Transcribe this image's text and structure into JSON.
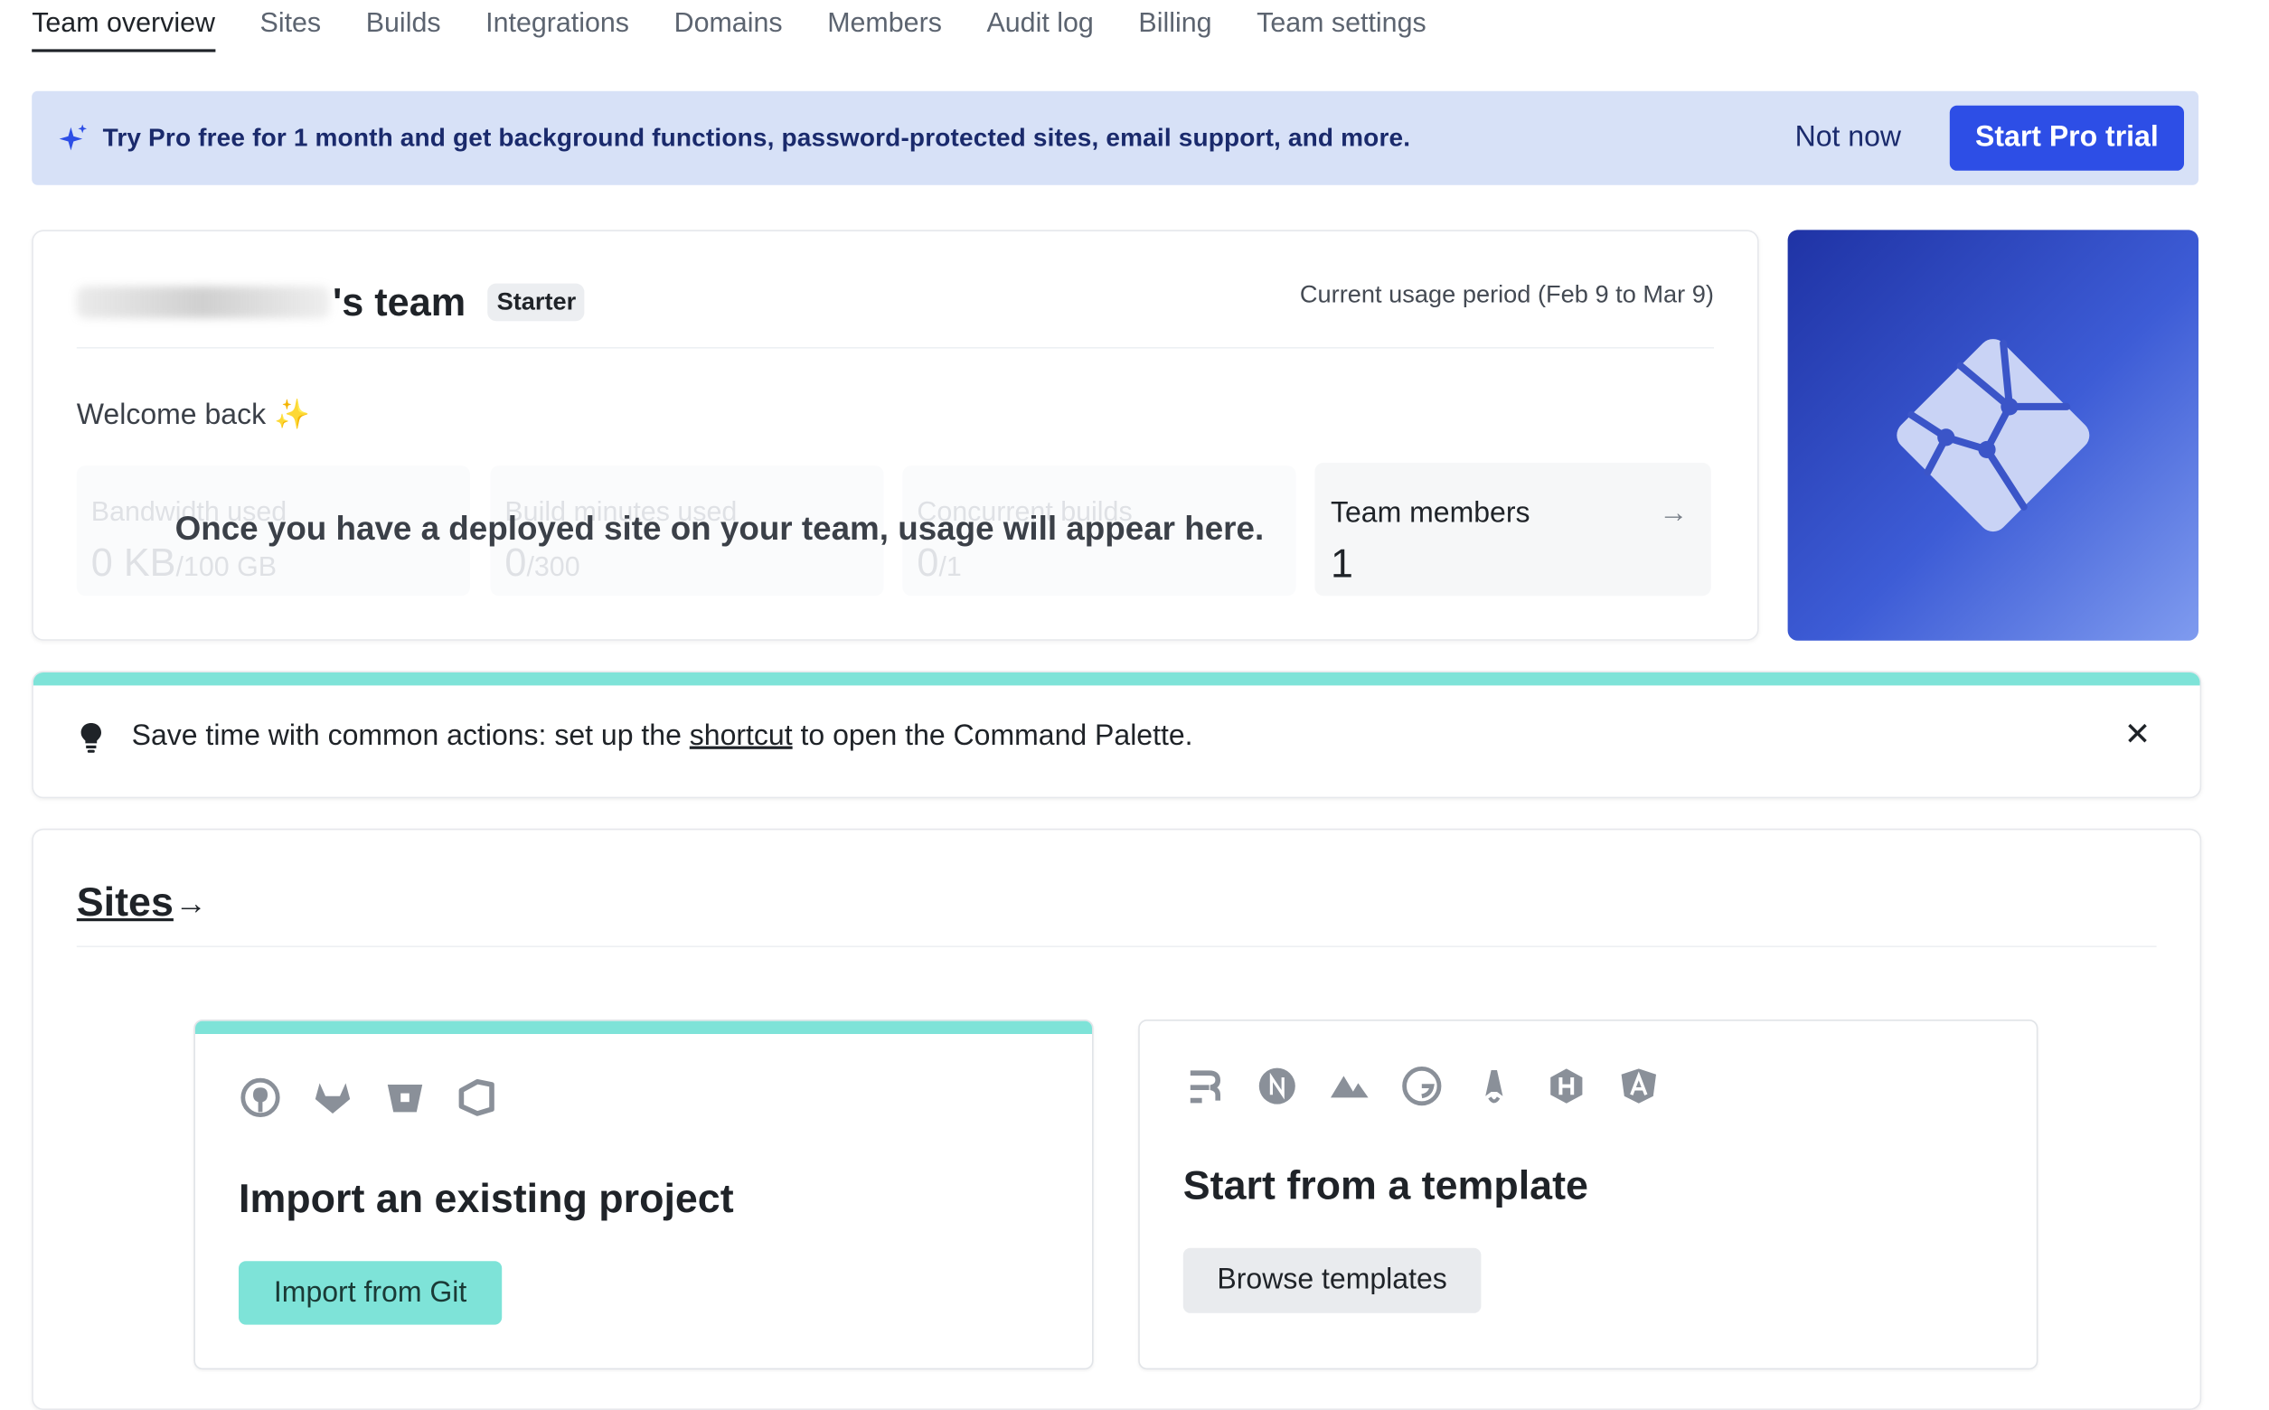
{
  "tabs": [
    "Team overview",
    "Sites",
    "Builds",
    "Integrations",
    "Domains",
    "Members",
    "Audit log",
    "Billing",
    "Team settings"
  ],
  "promo": {
    "text": "Try Pro free for 1 month and get background functions, password-protected sites, email support, and more.",
    "not_now": "Not now",
    "start_trial": "Start Pro trial"
  },
  "team": {
    "name_suffix": "'s team",
    "plan_badge": "Starter",
    "usage_period": "Current usage period (Feb 9 to Mar 9)",
    "welcome": "Welcome back ✨",
    "stats": [
      {
        "label": "Bandwidth used",
        "value": "0 KB",
        "limit": "/100 GB"
      },
      {
        "label": "Build minutes used",
        "value": "0",
        "limit": "/300"
      },
      {
        "label": "Concurrent builds",
        "value": "0",
        "limit": "/1"
      }
    ],
    "overlay_message": "Once you have a deployed site on your team, usage will appear here.",
    "members_label": "Team members",
    "members_count": "1"
  },
  "tip": {
    "before": "Save time with common actions: set up the ",
    "link": "shortcut",
    "after": " to open the Command Palette."
  },
  "sites": {
    "title": "Sites",
    "import": {
      "heading": "Import an existing project",
      "button": "Import from Git",
      "providers": [
        "github-icon",
        "gitlab-icon",
        "bitbucket-icon",
        "azure-devops-icon"
      ]
    },
    "template": {
      "heading": "Start from a template",
      "button": "Browse templates",
      "frameworks": [
        "remix-icon",
        "nextjs-icon",
        "nuxt-icon",
        "gatsby-icon",
        "astro-icon",
        "hugo-icon",
        "angular-icon"
      ]
    }
  },
  "colors": {
    "accent": "#2d4ee6",
    "teal": "#7ee3d8",
    "promo_bg": "#d7e1f7"
  }
}
